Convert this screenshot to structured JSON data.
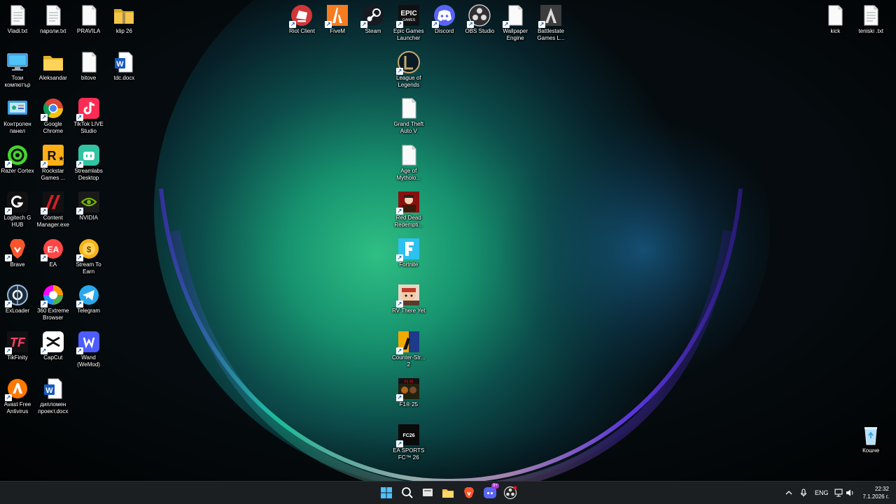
{
  "desktop": {
    "icons": [
      {
        "id": "vladi",
        "label": "Vladi.txt",
        "icon": "text-file-icon",
        "shortcut": false,
        "col": 0,
        "row": 0
      },
      {
        "id": "paroli",
        "label": "пароли.txt",
        "icon": "text-file-icon",
        "shortcut": false,
        "col": 1,
        "row": 0
      },
      {
        "id": "pravila",
        "label": "PRAVILA",
        "icon": "blank-file-icon",
        "shortcut": false,
        "col": 2,
        "row": 0
      },
      {
        "id": "klip",
        "label": "klip 26",
        "icon": "folder-zip-icon",
        "shortcut": false,
        "col": 3,
        "row": 0
      },
      {
        "id": "thispc",
        "label": "Този компютър",
        "icon": "computer-icon",
        "shortcut": false,
        "col": 0,
        "row": 1
      },
      {
        "id": "aleksandar",
        "label": "Aleksandar",
        "icon": "folder-icon",
        "shortcut": false,
        "col": 1,
        "row": 1
      },
      {
        "id": "bitove",
        "label": "bitove",
        "icon": "blank-file-icon",
        "shortcut": false,
        "col": 2,
        "row": 1
      },
      {
        "id": "tdc",
        "label": "tdc.docx",
        "icon": "word-doc-icon",
        "shortcut": false,
        "col": 3,
        "row": 1
      },
      {
        "id": "controlpanel",
        "label": "Контролен панел",
        "icon": "control-panel-icon",
        "shortcut": false,
        "col": 0,
        "row": 2
      },
      {
        "id": "chrome",
        "label": "Google Chrome",
        "icon": "chrome-icon",
        "shortcut": true,
        "col": 1,
        "row": 2
      },
      {
        "id": "tiktok",
        "label": "TikTok LIVE Studio",
        "icon": "tiktok-icon",
        "shortcut": true,
        "col": 2,
        "row": 2
      },
      {
        "id": "razer",
        "label": "Razer Cortex",
        "icon": "razer-icon",
        "shortcut": true,
        "col": 0,
        "row": 3
      },
      {
        "id": "rockstar",
        "label": "Rockstar Games ...",
        "icon": "rockstar-icon",
        "shortcut": true,
        "col": 1,
        "row": 3
      },
      {
        "id": "streamlabs",
        "label": "Streamlabs Desktop",
        "icon": "streamlabs-icon",
        "shortcut": true,
        "col": 2,
        "row": 3
      },
      {
        "id": "logitech",
        "label": "Logitech G HUB",
        "icon": "logitech-icon",
        "shortcut": true,
        "col": 0,
        "row": 4
      },
      {
        "id": "contentmgr",
        "label": "Content Manager.exe",
        "icon": "content-manager-icon",
        "shortcut": true,
        "col": 1,
        "row": 4
      },
      {
        "id": "nvidia",
        "label": "NVIDIA",
        "icon": "nvidia-icon",
        "shortcut": true,
        "col": 2,
        "row": 4
      },
      {
        "id": "brave",
        "label": "Brave",
        "icon": "brave-icon",
        "shortcut": true,
        "col": 0,
        "row": 5
      },
      {
        "id": "ea",
        "label": "EA",
        "icon": "ea-icon",
        "shortcut": true,
        "col": 1,
        "row": 5
      },
      {
        "id": "streamtoearn",
        "label": "Stream To Earn",
        "icon": "stream-to-earn-icon",
        "shortcut": true,
        "col": 2,
        "row": 5
      },
      {
        "id": "exloader",
        "label": "ExLoader",
        "icon": "exloader-icon",
        "shortcut": true,
        "col": 0,
        "row": 6
      },
      {
        "id": "360",
        "label": "360 Extreme Browser",
        "icon": "360-browser-icon",
        "shortcut": true,
        "col": 1,
        "row": 6
      },
      {
        "id": "telegram",
        "label": "Telegram",
        "icon": "telegram-icon",
        "shortcut": true,
        "col": 2,
        "row": 6
      },
      {
        "id": "tikfinity",
        "label": "TikFinity",
        "icon": "tikfinity-icon",
        "shortcut": true,
        "col": 0,
        "row": 7
      },
      {
        "id": "capcut",
        "label": "CapCut",
        "icon": "capcut-icon",
        "shortcut": true,
        "col": 1,
        "row": 7
      },
      {
        "id": "wand",
        "label": "Wand (WeMod)",
        "icon": "wand-icon",
        "shortcut": true,
        "col": 2,
        "row": 7
      },
      {
        "id": "avast",
        "label": "Avast Free Antivirus",
        "icon": "avast-icon",
        "shortcut": true,
        "col": 0,
        "row": 8
      },
      {
        "id": "diploma",
        "label": "дипломен проект.docx",
        "icon": "word-doc-icon",
        "shortcut": false,
        "col": 1,
        "row": 8
      },
      {
        "id": "riot",
        "label": "Riot Client",
        "icon": "riot-icon",
        "shortcut": true,
        "col": 8,
        "row": 0
      },
      {
        "id": "fivem",
        "label": "FiveM",
        "icon": "fivem-icon",
        "shortcut": true,
        "col": 9,
        "row": 0
      },
      {
        "id": "steam",
        "label": "Steam",
        "icon": "steam-icon",
        "shortcut": true,
        "col": 10,
        "row": 0
      },
      {
        "id": "epic",
        "label": "Epic Games Launcher",
        "icon": "epic-games-icon",
        "shortcut": true,
        "col": 11,
        "row": 0
      },
      {
        "id": "discord",
        "label": "Discord",
        "icon": "discord-icon",
        "shortcut": true,
        "col": 12,
        "row": 0
      },
      {
        "id": "obs",
        "label": "OBS Studio",
        "icon": "obs-icon",
        "shortcut": true,
        "col": 13,
        "row": 0
      },
      {
        "id": "wallpaper",
        "label": "Wallpaper Engine",
        "icon": "blank-file-icon",
        "shortcut": true,
        "col": 14,
        "row": 0
      },
      {
        "id": "battlestate",
        "label": "Battlestate Games L...",
        "icon": "battlestate-icon",
        "shortcut": true,
        "col": 15,
        "row": 0
      },
      {
        "id": "lol",
        "label": "League of Legends",
        "icon": "league-icon",
        "shortcut": true,
        "col": 11,
        "row": 1
      },
      {
        "id": "gta",
        "label": "Grand Theft Auto V",
        "icon": "blank-file-icon",
        "shortcut": false,
        "col": 11,
        "row": 2
      },
      {
        "id": "aom",
        "label": "Age of Mytholo...",
        "icon": "blank-file-icon",
        "shortcut": false,
        "col": 11,
        "row": 3
      },
      {
        "id": "rdr",
        "label": "Red Dead Redempti...",
        "icon": "red-dead-icon",
        "shortcut": true,
        "col": 11,
        "row": 4
      },
      {
        "id": "fortnite",
        "label": "Fortnite",
        "icon": "fortnite-icon",
        "shortcut": true,
        "col": 11,
        "row": 5
      },
      {
        "id": "rv",
        "label": "RV There Yet",
        "icon": "rv-there-yet-icon",
        "shortcut": true,
        "col": 11,
        "row": 6
      },
      {
        "id": "cs2",
        "label": "Counter-Str... 2",
        "icon": "counter-strike-icon",
        "shortcut": true,
        "col": 11,
        "row": 7
      },
      {
        "id": "f1",
        "label": "F1® 25",
        "icon": "f1-icon",
        "shortcut": true,
        "col": 11,
        "row": 8
      },
      {
        "id": "fc26",
        "label": "EA SPORTS FC™ 26",
        "icon": "ea-fc-icon",
        "shortcut": true,
        "col": 11,
        "row": 9
      },
      {
        "id": "kick",
        "label": "kick",
        "icon": "blank-file-icon",
        "shortcut": false,
        "col": 23,
        "row": 0
      },
      {
        "id": "teniski",
        "label": "teniski .txt",
        "icon": "text-file-icon",
        "shortcut": false,
        "col": 24,
        "row": 0
      },
      {
        "id": "recycle",
        "label": "Кошче",
        "icon": "recycle-bin-icon",
        "shortcut": false,
        "col": 24,
        "row": 9
      }
    ]
  },
  "taskbar": {
    "buttons": [
      {
        "name": "start-button",
        "icon": "windows-logo-icon"
      },
      {
        "name": "search-button",
        "icon": "search-icon"
      },
      {
        "name": "task-view-button",
        "icon": "task-view-icon"
      },
      {
        "name": "file-explorer-button",
        "icon": "folder-icon"
      },
      {
        "name": "brave-taskbar-button",
        "icon": "brave-icon"
      },
      {
        "name": "discord-taskbar-button",
        "icon": "discord-icon",
        "badge": "9+"
      },
      {
        "name": "obs-taskbar-button",
        "icon": "obs-icon"
      }
    ],
    "tray": {
      "language": "ENG",
      "time": "22:32",
      "date": "7.1.2026 г."
    }
  }
}
